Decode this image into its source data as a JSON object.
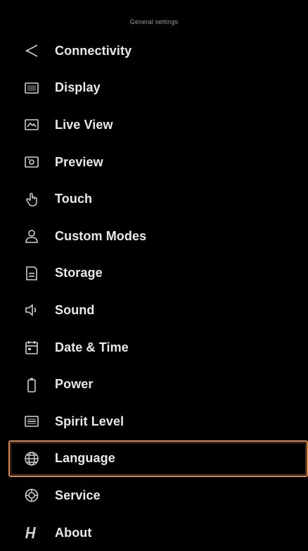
{
  "header": {
    "title": "General settings"
  },
  "menu": {
    "selected_index": 11,
    "items": [
      {
        "label": "Connectivity",
        "icon": "share-icon"
      },
      {
        "label": "Display",
        "icon": "display-icon"
      },
      {
        "label": "Live View",
        "icon": "live-view-icon"
      },
      {
        "label": "Preview",
        "icon": "preview-icon"
      },
      {
        "label": "Touch",
        "icon": "touch-icon"
      },
      {
        "label": "Custom Modes",
        "icon": "user-icon"
      },
      {
        "label": "Storage",
        "icon": "storage-icon"
      },
      {
        "label": "Sound",
        "icon": "speaker-icon"
      },
      {
        "label": "Date & Time",
        "icon": "calendar-icon"
      },
      {
        "label": "Power",
        "icon": "battery-icon"
      },
      {
        "label": "Spirit Level",
        "icon": "spirit-level-icon"
      },
      {
        "label": "Language",
        "icon": "globe-icon"
      },
      {
        "label": "Service",
        "icon": "service-icon"
      },
      {
        "label": "About",
        "icon": "brand-logo-icon"
      }
    ]
  },
  "colors": {
    "background": "#000000",
    "text": "#e9e9e9",
    "selection_outline": "#e08a3a"
  }
}
